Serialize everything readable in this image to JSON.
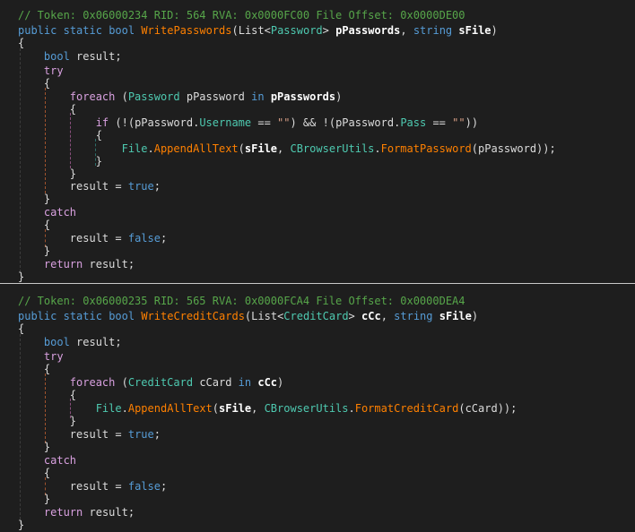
{
  "method1": {
    "comment": "// Token: 0x06000234 RID: 564 RVA: 0x0000FC00 File Offset: 0x0000DE00",
    "mod1": "public",
    "mod2": "static",
    "ret": "bool",
    "name": "WritePasswords",
    "list": "List",
    "elem": "Password",
    "param1": "pPasswords",
    "strkw": "string",
    "param2": "sFile",
    "boolkw": "bool",
    "resultvar": "result",
    "trykw": "try",
    "foreachkw": "foreach",
    "loopvar": "pPassword",
    "inkw": "in",
    "ifkw": "if",
    "field1": "Username",
    "field2": "Pass",
    "emptystr": "\"\"",
    "filecls": "File",
    "append": "AppendAllText",
    "utils": "CBrowserUtils",
    "format": "FormatPassword",
    "truekw": "true",
    "catchkw": "catch",
    "falsekw": "false",
    "returnkw": "return"
  },
  "method2": {
    "comment": "// Token: 0x06000235 RID: 565 RVA: 0x0000FCA4 File Offset: 0x0000DEA4",
    "mod1": "public",
    "mod2": "static",
    "ret": "bool",
    "name": "WriteCreditCards",
    "list": "List",
    "elem": "CreditCard",
    "param1": "cCc",
    "strkw": "string",
    "param2": "sFile",
    "boolkw": "bool",
    "resultvar": "result",
    "trykw": "try",
    "foreachkw": "foreach",
    "loopvar": "cCard",
    "inkw": "in",
    "filecls": "File",
    "append": "AppendAllText",
    "utils": "CBrowserUtils",
    "format": "FormatCreditCard",
    "truekw": "true",
    "catchkw": "catch",
    "falsekw": "false",
    "returnkw": "return"
  },
  "colors": {
    "background": "#1e1e1e",
    "comment": "#57a64a",
    "keyword": "#569cd6",
    "type": "#4ec9b0",
    "method": "#ff8000",
    "string": "#d69d85"
  }
}
